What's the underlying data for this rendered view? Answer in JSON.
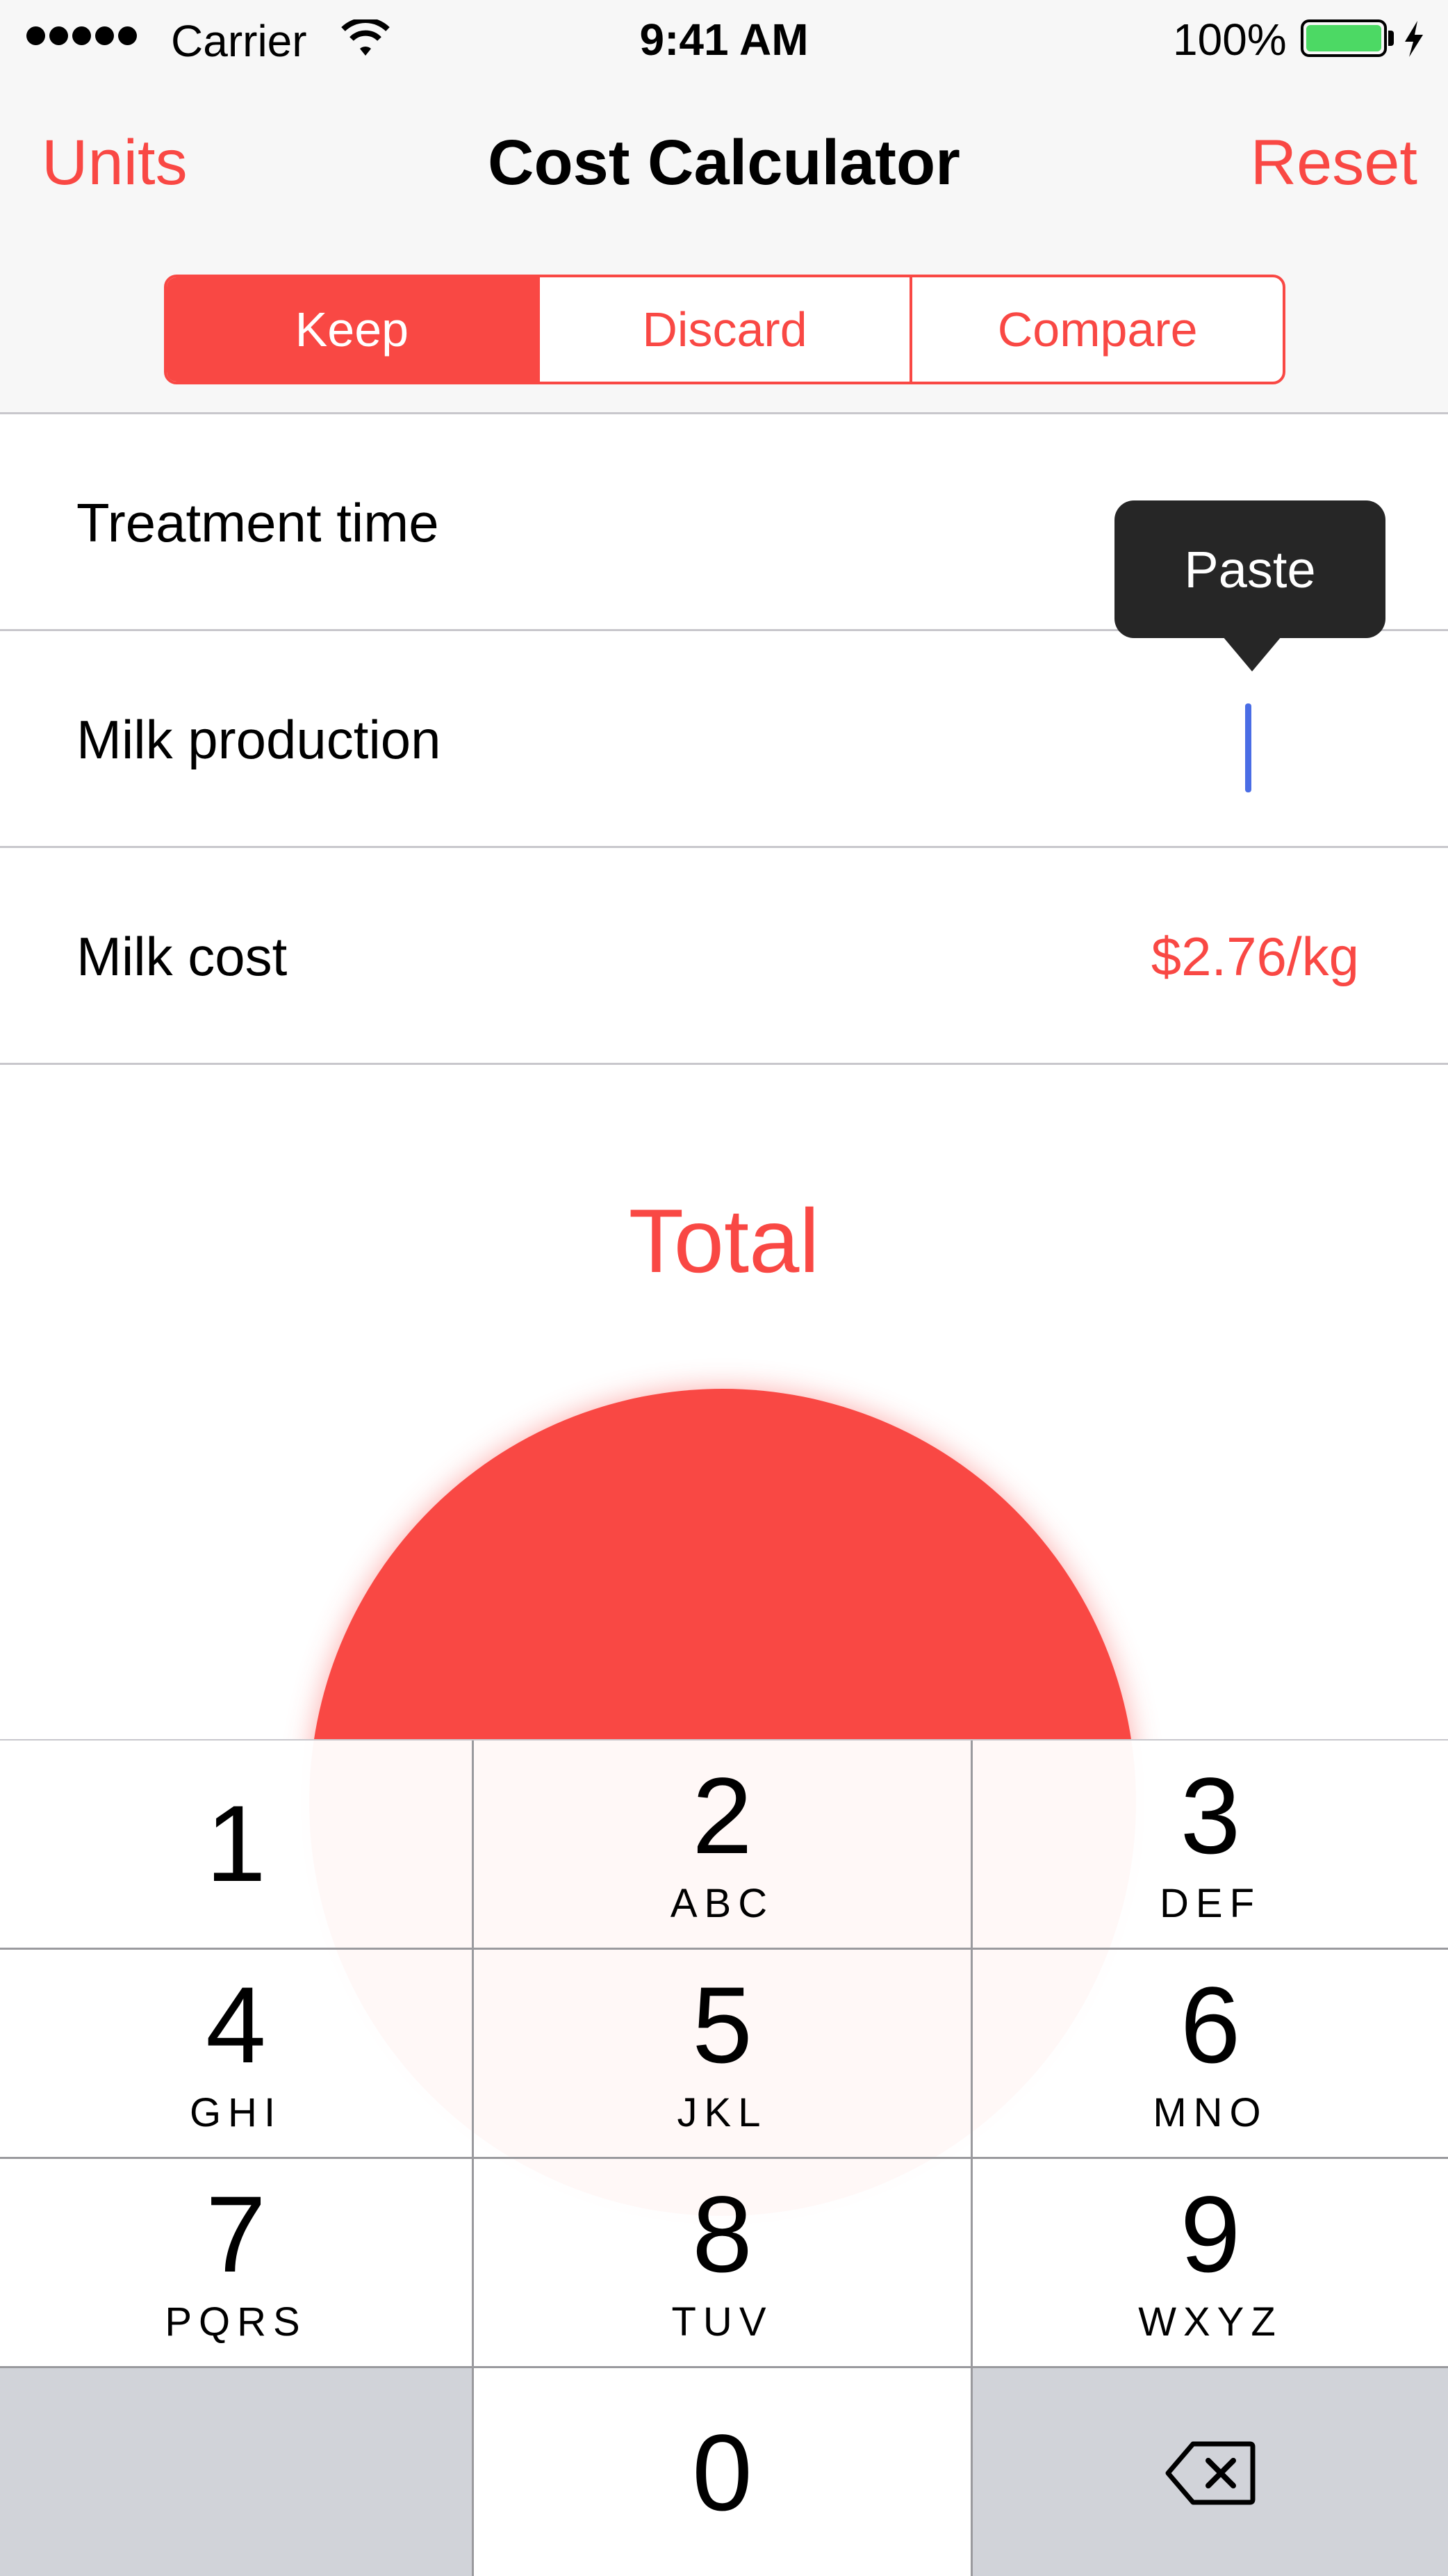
{
  "status_bar": {
    "carrier": "Carrier",
    "time": "9:41 AM",
    "battery_percent": "100%",
    "battery_level": 1.0,
    "battery_color": "#4cd964",
    "icons": [
      "signal-dots-icon",
      "wifi-icon",
      "battery-icon",
      "charging-bolt-icon"
    ]
  },
  "nav": {
    "left_button": "Units",
    "title": "Cost Calculator",
    "right_button": "Reset",
    "accent_color": "#f94844"
  },
  "segments": {
    "items": [
      "Keep",
      "Discard",
      "Compare"
    ],
    "selected": "Keep"
  },
  "rows": [
    {
      "label": "Treatment time",
      "value": ""
    },
    {
      "label": "Milk production",
      "value": ""
    },
    {
      "label": "Milk cost",
      "value": "$2.76/kg"
    }
  ],
  "paste_menu": {
    "label": "Paste"
  },
  "total": {
    "label": "Total"
  },
  "keypad": {
    "keys": [
      {
        "num": "1",
        "letters": ""
      },
      {
        "num": "2",
        "letters": "ABC"
      },
      {
        "num": "3",
        "letters": "DEF"
      },
      {
        "num": "4",
        "letters": "GHI"
      },
      {
        "num": "5",
        "letters": "JKL"
      },
      {
        "num": "6",
        "letters": "MNO"
      },
      {
        "num": "7",
        "letters": "PQRS"
      },
      {
        "num": "8",
        "letters": "TUV"
      },
      {
        "num": "9",
        "letters": "WXYZ"
      },
      {
        "num": "",
        "letters": ""
      },
      {
        "num": "0",
        "letters": ""
      },
      {
        "num": "",
        "letters": "",
        "icon": "delete-backspace-icon"
      }
    ]
  }
}
